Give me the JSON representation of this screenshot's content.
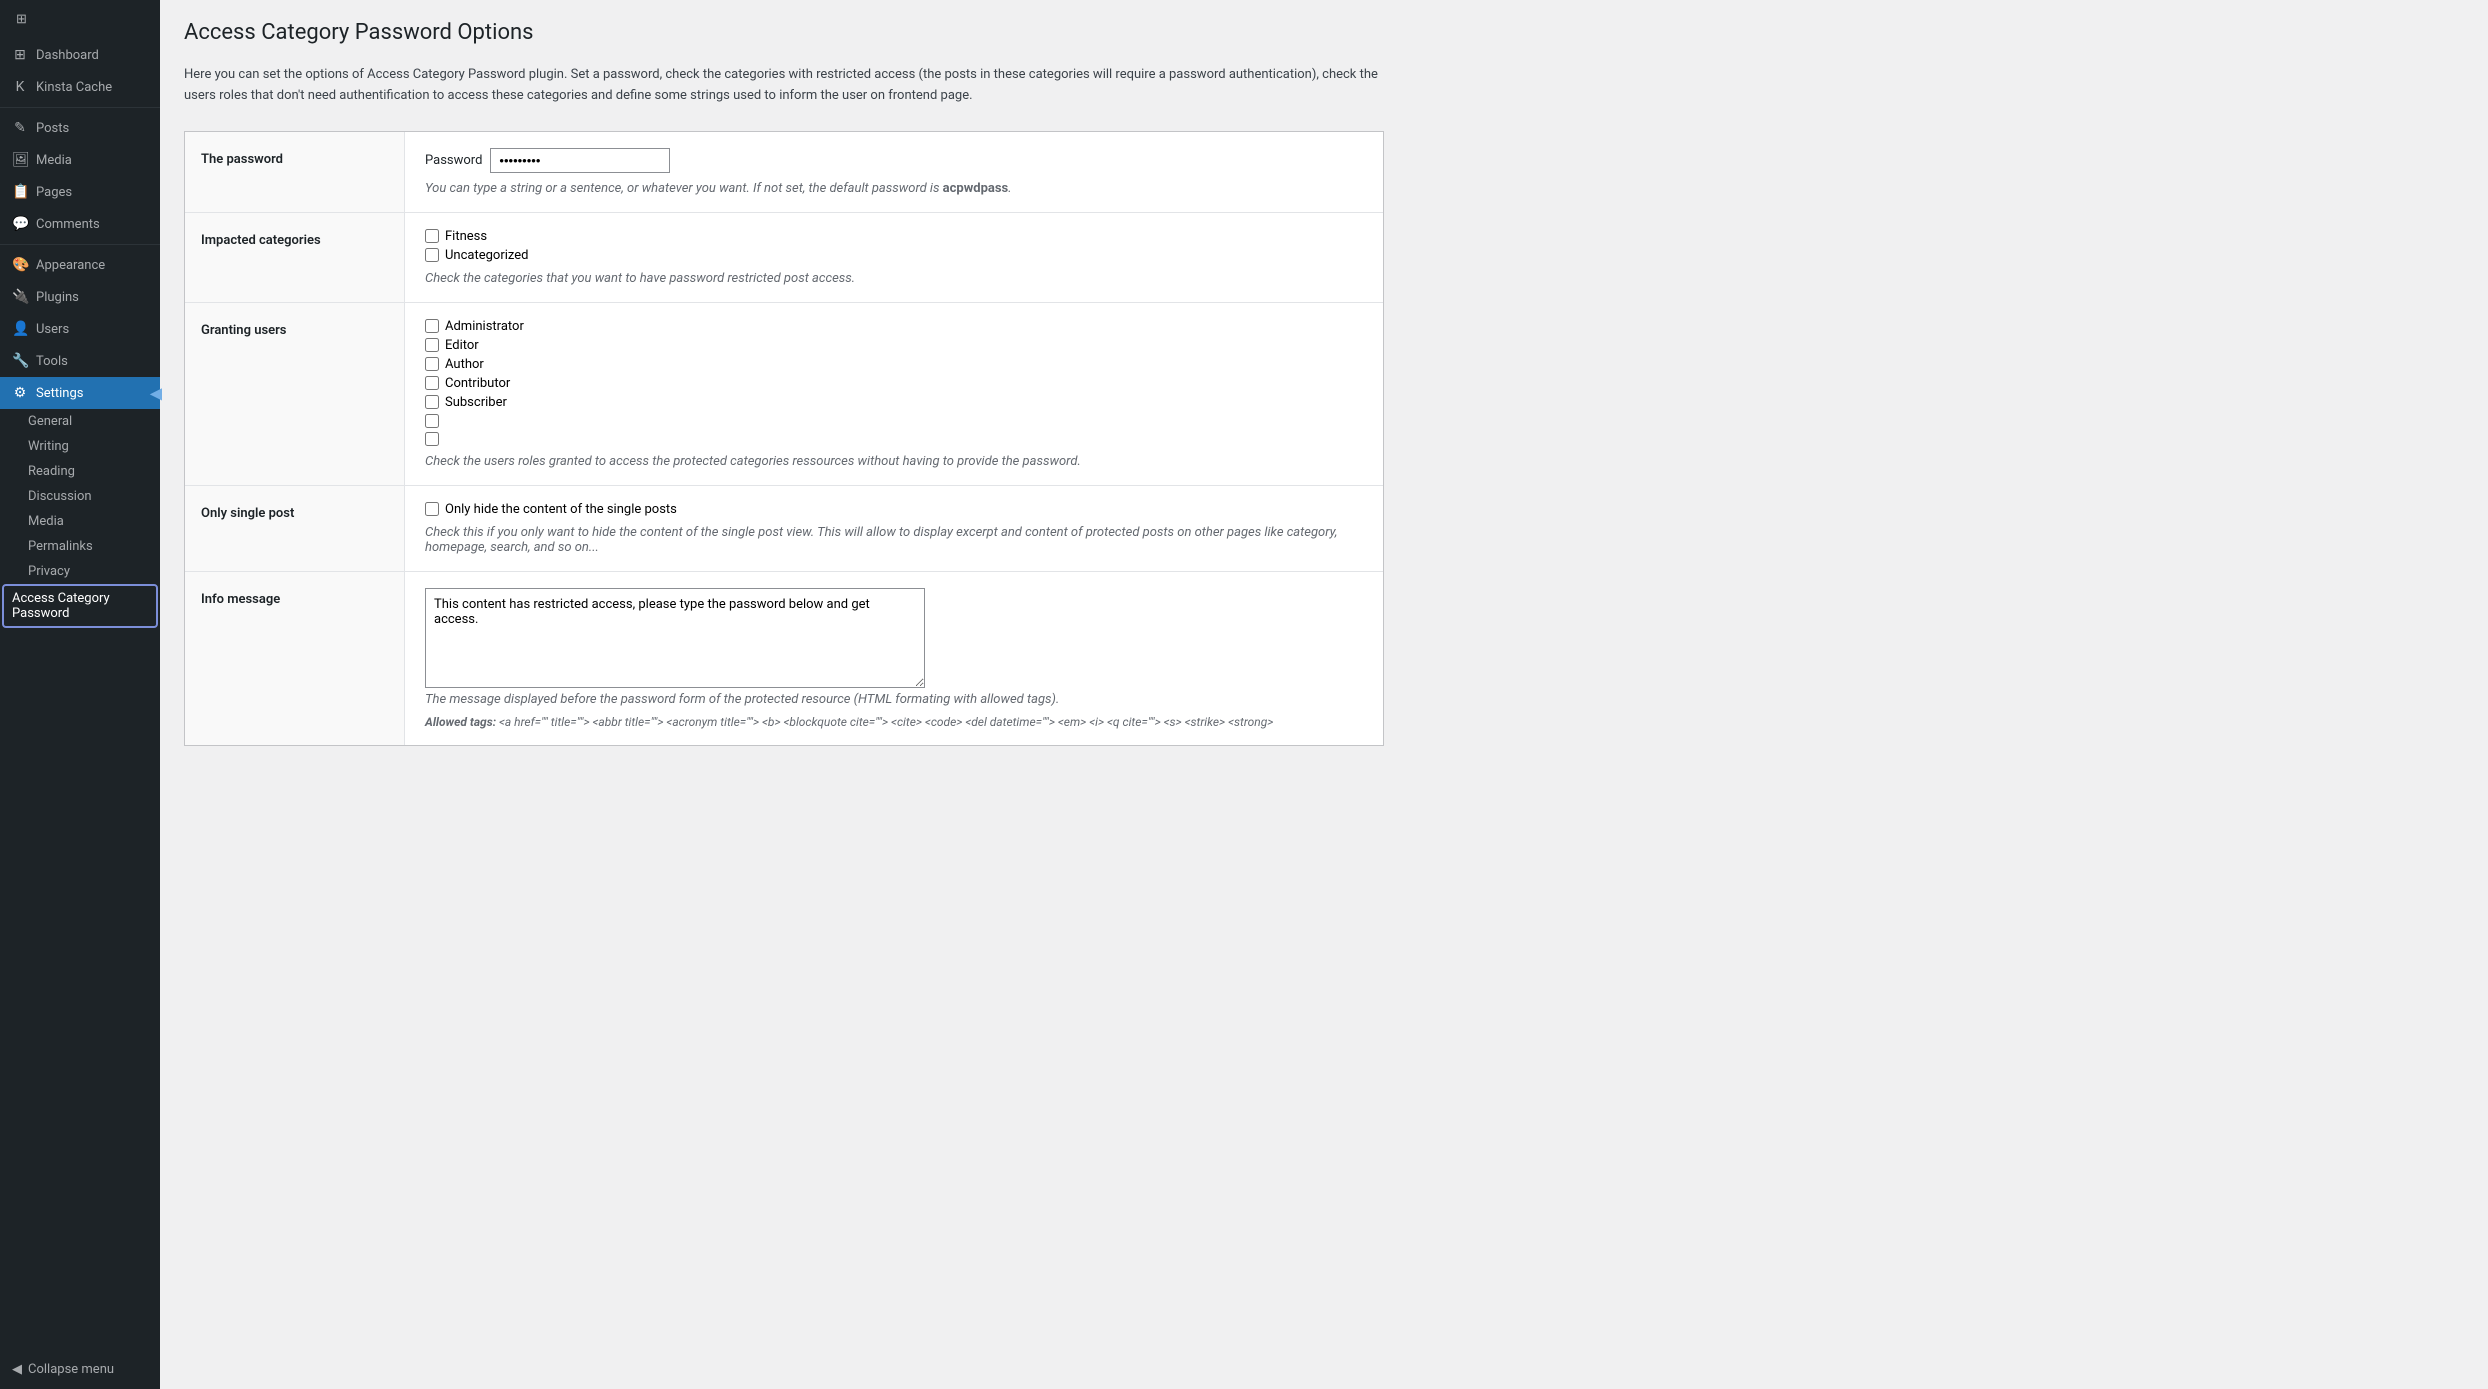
{
  "sidebar": {
    "items": [
      {
        "id": "dashboard",
        "label": "Dashboard",
        "icon": "⊞"
      },
      {
        "id": "kinsta-cache",
        "label": "Kinsta Cache",
        "icon": "K"
      },
      {
        "id": "posts",
        "label": "Posts",
        "icon": "📄"
      },
      {
        "id": "media",
        "label": "Media",
        "icon": "🖼"
      },
      {
        "id": "pages",
        "label": "Pages",
        "icon": "📋"
      },
      {
        "id": "comments",
        "label": "Comments",
        "icon": "💬"
      },
      {
        "id": "appearance",
        "label": "Appearance",
        "icon": "🎨"
      },
      {
        "id": "plugins",
        "label": "Plugins",
        "icon": "🔌"
      },
      {
        "id": "users",
        "label": "Users",
        "icon": "👤"
      },
      {
        "id": "tools",
        "label": "Tools",
        "icon": "🔧"
      },
      {
        "id": "settings",
        "label": "Settings",
        "icon": "⚙"
      }
    ],
    "submenu": [
      {
        "id": "general",
        "label": "General"
      },
      {
        "id": "writing",
        "label": "Writing"
      },
      {
        "id": "reading",
        "label": "Reading"
      },
      {
        "id": "discussion",
        "label": "Discussion"
      },
      {
        "id": "media",
        "label": "Media"
      },
      {
        "id": "permalinks",
        "label": "Permalinks"
      },
      {
        "id": "privacy",
        "label": "Privacy"
      },
      {
        "id": "access-category-password",
        "label": "Access Category Password",
        "active": true
      }
    ],
    "collapse_label": "Collapse menu"
  },
  "main": {
    "page_title": "Access Category Password Options",
    "description": "Here you can set the options of Access Category Password plugin. Set a password, check the categories with restricted access (the posts in these categories will require a password authentication), check the users roles that don't need authentification to access these categories and define some strings used to inform the user on frontend page.",
    "sections": [
      {
        "id": "password",
        "label": "The password",
        "field_label": "Password",
        "field_value": "•••••••••",
        "hint": "You can type a string or a sentence, or whatever you want. If not set, the default password is ",
        "hint_strong": "acpwdpass",
        "hint_end": "."
      },
      {
        "id": "impacted-categories",
        "label": "Impacted categories",
        "options": [
          "Fitness",
          "Uncategorized"
        ],
        "hint": "Check the categories that you want to have password restricted post access."
      },
      {
        "id": "granting-users",
        "label": "Granting users",
        "options": [
          "Administrator",
          "Editor",
          "Author",
          "Contributor",
          "Subscriber",
          "",
          ""
        ],
        "hint": "Check the users roles granted to access the protected categories ressources without having to provide the password."
      },
      {
        "id": "only-single-post",
        "label": "Only single post",
        "option_label": "Only hide the content of the single posts",
        "hint": "Check this if you only want to hide the content of the single post view. This will allow to display excerpt and content of protected posts on other pages like category, homepage, search, and so on..."
      },
      {
        "id": "info-message",
        "label": "Info message",
        "textarea_value": "This content has restricted access, please type the password below and get access.",
        "hint": "The message displayed before the password form of the protected resource (HTML formating with allowed tags).",
        "allowed_tags_label": "Allowed tags:",
        "allowed_tags": " <a href=\"\" title=\"\"> <abbr title=\"\"> <acronym title=\"\"> <b> <blockquote cite=\"\"> <cite> <code> <del datetime=\"\"> <em> <i> <q cite=\"\"> <s> <strike> <strong>"
      }
    ]
  }
}
